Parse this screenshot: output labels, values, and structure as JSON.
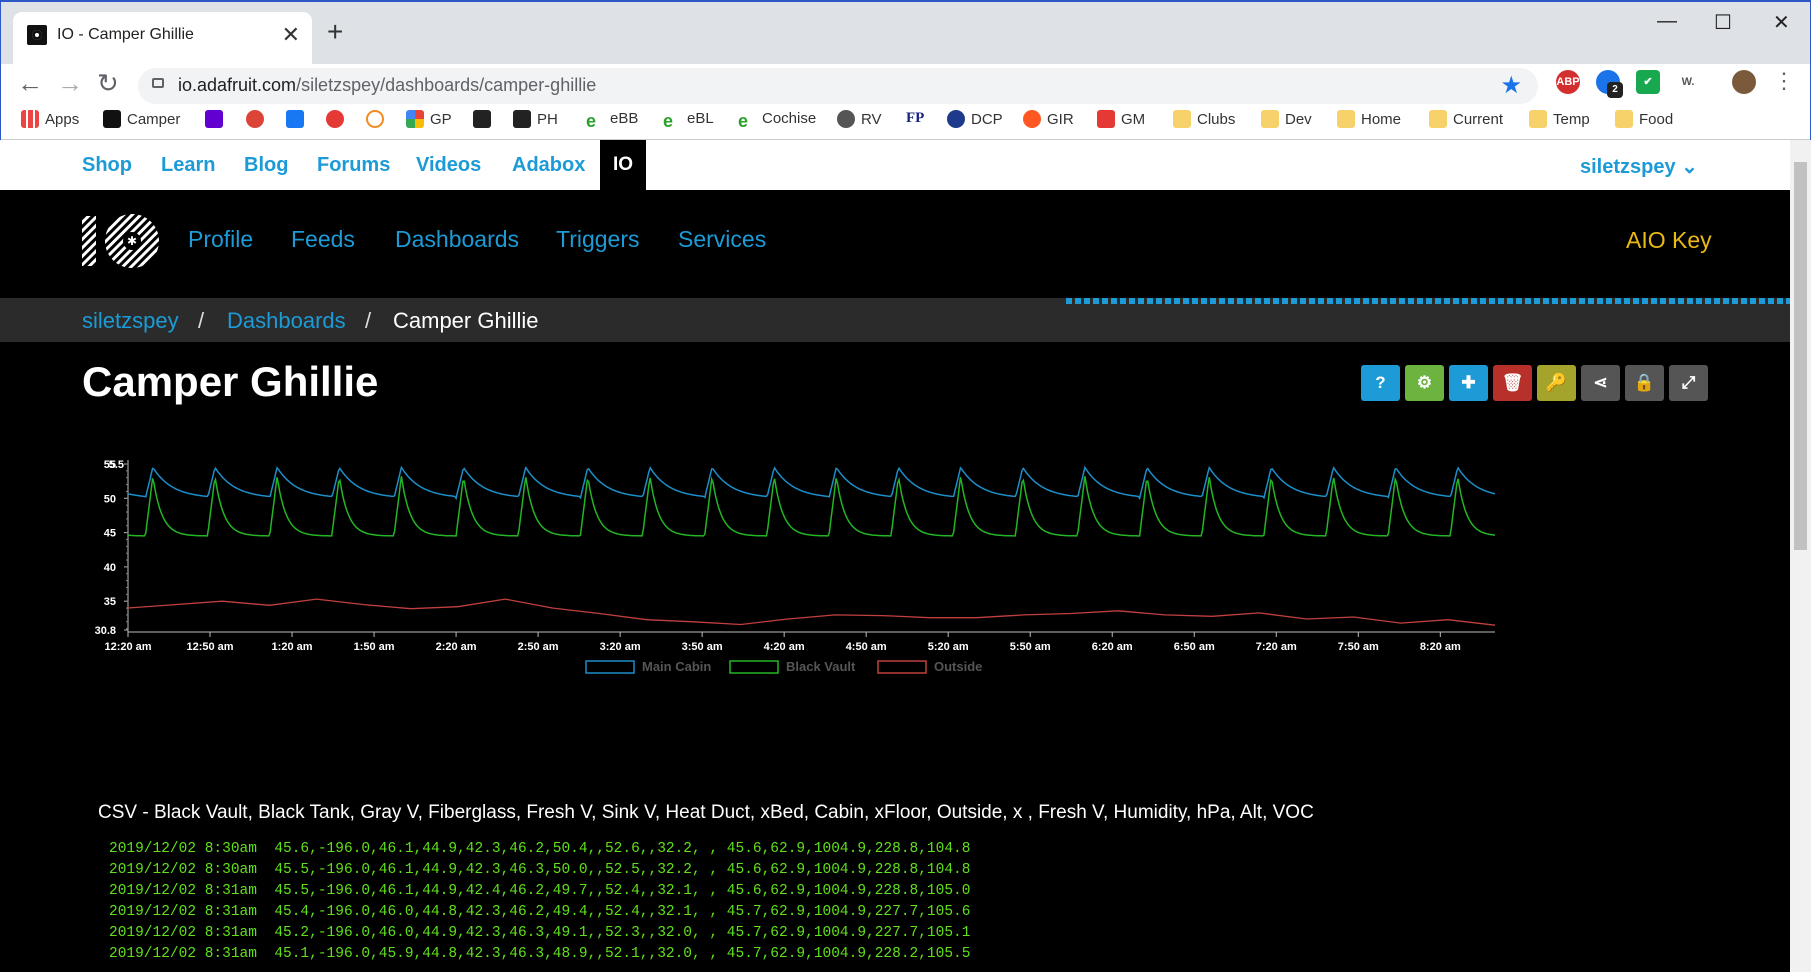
{
  "browser": {
    "tab_title": "IO - Camper Ghillie",
    "tab_close": "✕",
    "new_tab": "+",
    "url_host": "io.adafruit.com",
    "url_path": "/siletzspey/dashboards/camper-ghillie",
    "window_controls": [
      "—",
      "☐",
      "✕"
    ],
    "extension_badge": "2",
    "bookmarks": [
      "Apps",
      "Camper",
      "GP",
      "PH",
      "eBB",
      "eBL",
      "Cochise",
      "RV",
      "FP",
      "DCP",
      "GIR",
      "GM",
      "Clubs",
      "Dev",
      "Home",
      "Current",
      "Temp",
      "Food"
    ]
  },
  "topnav": {
    "items": [
      "Shop",
      "Learn",
      "Blog",
      "Forums",
      "Videos",
      "Adabox"
    ],
    "active": "IO",
    "user": "siletzspey ⌄"
  },
  "io_nav": {
    "items": [
      "Profile",
      "Feeds",
      "Dashboards",
      "Triggers",
      "Services"
    ],
    "aio_key": "AIO Key"
  },
  "breadcrumb": {
    "user": "siletzspey",
    "sep": "/",
    "section": "Dashboards",
    "current": "Camper Ghillie"
  },
  "page_title": "Camper Ghillie",
  "toolbar": {
    "buttons": [
      {
        "name": "help",
        "glyph": "?",
        "color": "#1c9bd6"
      },
      {
        "name": "settings",
        "glyph": "⚙",
        "color": "#6cb33f"
      },
      {
        "name": "add-block",
        "glyph": "✚",
        "color": "#1c9bd6"
      },
      {
        "name": "delete",
        "glyph": "🗑",
        "color": "#b8302a"
      },
      {
        "name": "key",
        "glyph": "🔑",
        "color": "#a4a32c"
      },
      {
        "name": "share",
        "glyph": "⋖",
        "color": "#555555"
      },
      {
        "name": "lock",
        "glyph": "🔒",
        "color": "#555555"
      },
      {
        "name": "fullscreen",
        "glyph": "⤢",
        "color": "#555555"
      }
    ]
  },
  "chart_data": {
    "type": "line",
    "ylim": [
      30.8,
      55
    ],
    "y_ticks": [
      "30.8",
      "35",
      "40",
      "45",
      "50",
      "55"
    ],
    "y_tick_overlap": "5.5",
    "x_ticks": [
      "12:20 am",
      "12:50 am",
      "1:20 am",
      "1:50 am",
      "2:20 am",
      "2:50 am",
      "3:20 am",
      "3:50 am",
      "4:20 am",
      "4:50 am",
      "5:20 am",
      "5:50 am",
      "6:20 am",
      "6:50 am",
      "7:20 am",
      "7:50 am",
      "8:20 am"
    ],
    "series": [
      {
        "name": "Main Cabin",
        "color": "#1c8ec9",
        "cycle_period_min": 10.6,
        "low": 50,
        "high": 54.5,
        "cycles": 22
      },
      {
        "name": "Black Vault",
        "color": "#23b524",
        "cycle_period_min": 10.6,
        "low": 44.5,
        "high": 53.2,
        "cycles": 22
      },
      {
        "name": "Outside",
        "color": "#c0403f",
        "values": [
          34.0,
          34.5,
          35.0,
          34.4,
          35.3,
          34.5,
          33.9,
          34.2,
          35.3,
          34.0,
          33.2,
          32.3,
          32.0,
          31.6,
          32.4,
          33.0,
          32.9,
          32.6,
          32.6,
          33.0,
          33.2,
          33.6,
          33.0,
          32.8,
          33.3,
          32.4,
          32.7,
          31.8,
          32.3,
          31.5
        ]
      }
    ],
    "legend_position": "bottom-center"
  },
  "csv": {
    "header": "CSV - Black Vault, Black Tank, Gray V, Fiberglass, Fresh V, Sink V, Heat Duct, xBed, Cabin, xFloor, Outside, x , Fresh V, Humidity, hPa, Alt, VOC",
    "rows": [
      "2019/12/02 8:30am  45.6,-196.0,46.1,44.9,42.3,46.2,50.4,,52.6,,32.2, , 45.6,62.9,1004.9,228.8,104.8",
      "2019/12/02 8:30am  45.5,-196.0,46.1,44.9,42.3,46.3,50.0,,52.5,,32.2, , 45.6,62.9,1004.9,228.8,104.8",
      "2019/12/02 8:31am  45.5,-196.0,46.1,44.9,42.4,46.2,49.7,,52.4,,32.1, , 45.6,62.9,1004.9,228.8,105.0",
      "2019/12/02 8:31am  45.4,-196.0,46.0,44.8,42.3,46.2,49.4,,52.4,,32.1, , 45.7,62.9,1004.9,227.7,105.6",
      "2019/12/02 8:31am  45.2,-196.0,46.0,44.9,42.3,46.3,49.1,,52.3,,32.0, , 45.7,62.9,1004.9,227.7,105.1",
      "2019/12/02 8:31am  45.1,-196.0,45.9,44.8,42.3,46.3,48.9,,52.1,,32.0, , 45.7,62.9,1004.9,228.2,105.5"
    ]
  }
}
